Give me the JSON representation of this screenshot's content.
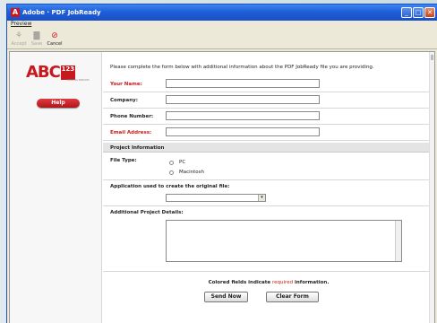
{
  "window": {
    "title": "Adobe · PDF JobReady",
    "app_icon_glyph": "A",
    "controls": {
      "minimize": "_",
      "maximize": "□",
      "close": "✕"
    }
  },
  "menu": {
    "items": [
      "Preview"
    ]
  },
  "toolbar": {
    "accept_label": "Accept",
    "save_label": "Save",
    "cancel_label": "Cancel"
  },
  "sidebar": {
    "logo_text": "ABC",
    "logo_badge": "123",
    "logo_sub": "PRINTING SERVICES",
    "help_label": "Help"
  },
  "form": {
    "intro": "Please complete the form below with additional information about the PDF JobReady file you are providing.",
    "your_name_label": "Your Name:",
    "company_label": "Company:",
    "phone_label": "Phone Number:",
    "email_label": "Email Address:",
    "section_label": "Project Information",
    "file_type_label": "File Type:",
    "file_type_options": [
      "PC",
      "Macintosh"
    ],
    "application_label": "Application used to create the original file:",
    "details_label": "Additional Project Details:",
    "note_prefix": "Colored fields indicate",
    "note_required": "required",
    "note_suffix": "information.",
    "send_label": "Send Now",
    "clear_label": "Clear Form"
  },
  "colors": {
    "required": "#d01818",
    "titlebar": "#1f5fd8",
    "brand": "#c8181e"
  }
}
